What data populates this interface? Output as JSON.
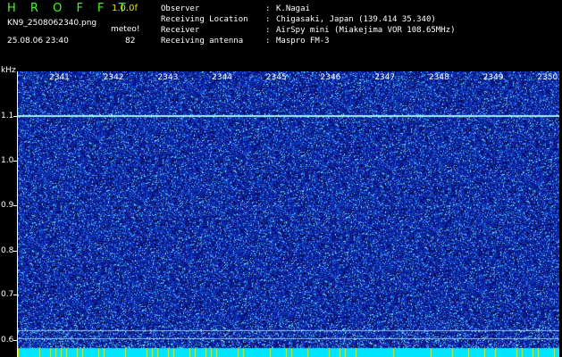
{
  "header": {
    "title": "H R O F F T",
    "version": "1.0.0f",
    "filename": "KN9_2508062340.png",
    "station_label": "meteo!",
    "timestamp": "25.08.06 23:40",
    "station_value": "82"
  },
  "info": [
    {
      "label": "Observer",
      "value": "K.Nagai"
    },
    {
      "label": "Receiving Location",
      "value": "Chigasaki, Japan (139.414 35.340)"
    },
    {
      "label": "Receiver",
      "value": "AirSpy mini (Miakejima VOR 108.65MHz)"
    },
    {
      "label": "Receiving antenna",
      "value": "Maspro FM-3"
    }
  ],
  "info_separator": ":",
  "axis": {
    "y_unit": "kHz",
    "y_ticks": [
      "1.1",
      "1.0",
      "0.9",
      "0.8",
      "0.7",
      "0.6"
    ],
    "x_ticks": [
      "2341",
      "2342",
      "2343",
      "2344",
      "2345",
      "2346",
      "2347",
      "2348",
      "2349",
      "2350"
    ]
  },
  "colors": {
    "background": "#000000",
    "waterfall_base": "#0b1f9a",
    "title_green": "#39ff14",
    "accent_yellow": "#e6e600",
    "bottom_band": "#00e5ff"
  }
}
